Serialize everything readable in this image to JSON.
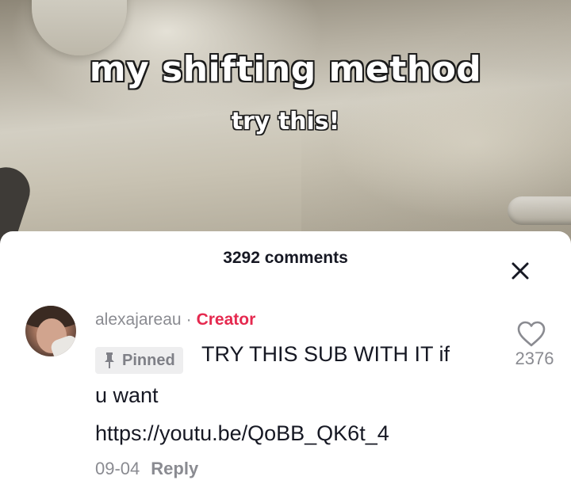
{
  "video": {
    "overlay_title": "my shifting method",
    "overlay_subtitle": "try this!"
  },
  "comments_panel": {
    "header": "3292 comments",
    "close_icon": "close-icon"
  },
  "comment": {
    "username": "alexajareau",
    "separator": "·",
    "role_badge": "Creator",
    "pinned_label": "Pinned",
    "text_line1": "TRY THIS SUB WITH IT if",
    "text_line2": "u want",
    "text_line3": "https://youtu.be/QoBB_QK6t_4",
    "date": "09-04",
    "reply_label": "Reply",
    "like_count": "2376",
    "like_icon": "heart-outline-icon",
    "pin_icon": "pin-icon"
  },
  "colors": {
    "creator_accent": "#e5294f",
    "primary_text": "#161823",
    "secondary_text": "#8a8b91"
  }
}
